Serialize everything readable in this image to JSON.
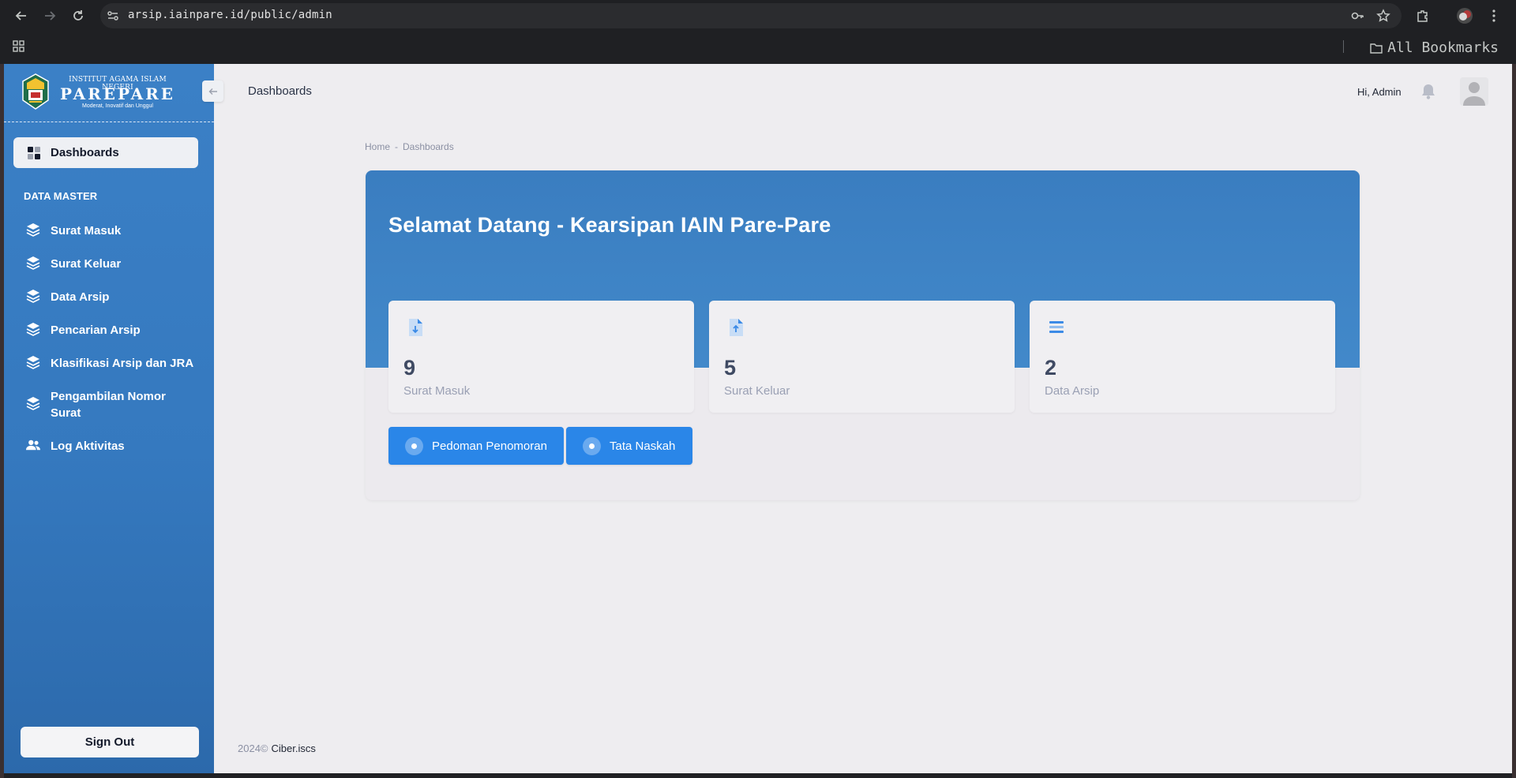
{
  "browser": {
    "url": "arsip.iainpare.id/public/admin",
    "bookmarks_label": "All Bookmarks"
  },
  "sidebar": {
    "logo": {
      "line1": "INSTITUT AGAMA ISLAM NEGERI",
      "line2": "PAREPARE",
      "line3": "Moderat, Inovatif dan Unggul"
    },
    "active_item": "Dashboards",
    "section_label": "DATA MASTER",
    "items": [
      {
        "label": "Surat Masuk",
        "icon": "layers-icon"
      },
      {
        "label": "Surat Keluar",
        "icon": "layers-icon"
      },
      {
        "label": "Data Arsip",
        "icon": "layers-icon"
      },
      {
        "label": "Pencarian Arsip",
        "icon": "layers-icon"
      },
      {
        "label": "Klasifikasi Arsip dan JRA",
        "icon": "layers-icon"
      },
      {
        "label": "Pengambilan Nomor Surat",
        "icon": "layers-icon"
      },
      {
        "label": "Log Aktivitas",
        "icon": "users-icon"
      }
    ],
    "signout_label": "Sign Out"
  },
  "header": {
    "title": "Dashboards",
    "greeting": "Hi, Admin"
  },
  "breadcrumb": {
    "home": "Home",
    "separator": "-",
    "current": "Dashboards"
  },
  "hero": {
    "title": "Selamat Datang - Kearsipan IAIN Pare-Pare"
  },
  "stats": [
    {
      "value": "9",
      "label": "Surat Masuk",
      "icon": "file-download-icon"
    },
    {
      "value": "5",
      "label": "Surat Keluar",
      "icon": "file-upload-icon"
    },
    {
      "value": "2",
      "label": "Data Arsip",
      "icon": "list-icon"
    }
  ],
  "actions": [
    {
      "label": "Pedoman Penomoran"
    },
    {
      "label": "Tata Naskah"
    }
  ],
  "footer": {
    "year": "2024©",
    "brand": "Ciber.iscs"
  },
  "colors": {
    "sidebar": "#3579bf",
    "hero": "#3d82c4",
    "button": "#2a86e8",
    "page_bg": "#eeedf0"
  }
}
